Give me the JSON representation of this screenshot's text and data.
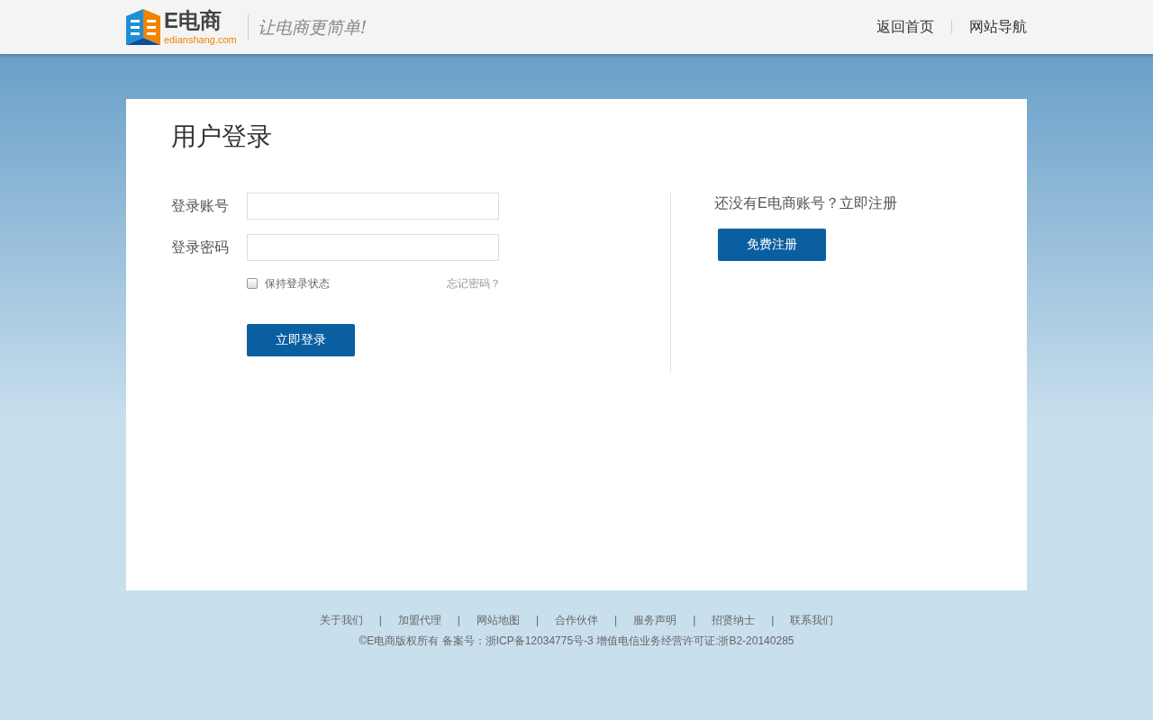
{
  "header": {
    "logo_mark": "E电商",
    "logo_domain": "edianshang.com",
    "slogan": "让电商更简单!",
    "nav": [
      {
        "label": "返回首页"
      },
      {
        "label": "网站导航"
      }
    ]
  },
  "login": {
    "title": "用户登录",
    "fields": [
      {
        "label": "登录账号"
      },
      {
        "label": "登录密码"
      }
    ],
    "remember": {
      "label": "保持登录状态",
      "checked": false
    },
    "forgot": "忘记密码？",
    "submit": "立即登录"
  },
  "register": {
    "prompt": "还没有E电商账号？立即注册",
    "button": "免费注册"
  },
  "footer": {
    "links": [
      "关于我们",
      "加盟代理",
      "网站地图",
      "合作伙伴",
      "服务声明",
      "招贤纳士",
      "联系我们"
    ],
    "separators": [
      "|",
      "|",
      "|",
      "|",
      "|",
      "|"
    ],
    "copyright": "©E电商版权所有 备案号：浙ICP备12034775号-3  增值电信业务经营许可证:浙B2-20140285"
  }
}
